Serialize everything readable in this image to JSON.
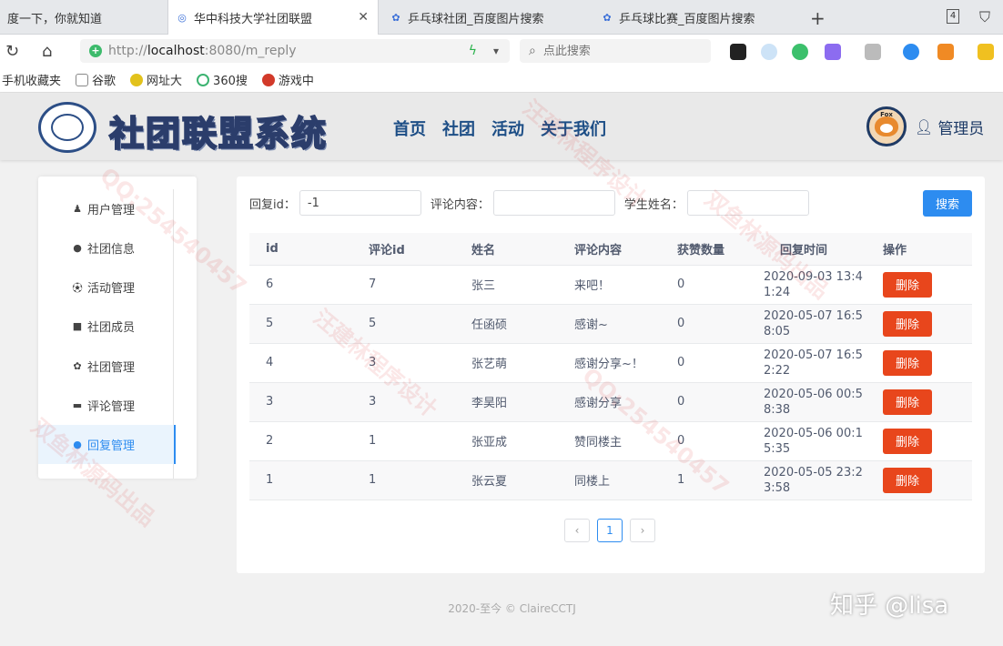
{
  "browser": {
    "tabs": [
      {
        "label": "度一下，你就知道",
        "active": false
      },
      {
        "label": "华中科技大学社团联盟",
        "active": true
      },
      {
        "label": "乒乓球社团_百度图片搜索",
        "active": false
      },
      {
        "label": "乒乓球比赛_百度图片搜索",
        "active": false
      }
    ],
    "tab_count": "4",
    "url_prefix": "http://",
    "url_host": "localhost",
    "url_rest": ":8080/m_reply",
    "search_placeholder": "点此搜索",
    "bookmarks": [
      "手机收藏夹",
      "谷歌",
      "网址大",
      "360搜",
      "游戏中"
    ]
  },
  "header": {
    "brand": "社团联盟系统",
    "nav": [
      "首页",
      "社团",
      "活动",
      "关于我们"
    ],
    "avatar_text": "Fox",
    "user": "管理员"
  },
  "sidebar": {
    "items": [
      {
        "label": "用户管理",
        "icon": "users-icon",
        "active": false
      },
      {
        "label": "社团信息",
        "icon": "chat-icon",
        "active": false
      },
      {
        "label": "活动管理",
        "icon": "ball-icon",
        "active": false
      },
      {
        "label": "社团成员",
        "icon": "folder-icon",
        "active": false
      },
      {
        "label": "社团管理",
        "icon": "gear-icon",
        "active": false
      },
      {
        "label": "评论管理",
        "icon": "comment-icon",
        "active": false
      },
      {
        "label": "回复管理",
        "icon": "reply-icon",
        "active": true
      }
    ]
  },
  "filters": {
    "reply_id_label": "回复id：",
    "reply_id_value": "-1",
    "comment_label": "评论内容：",
    "comment_value": "",
    "student_label": "学生姓名：",
    "student_value": "",
    "search_label": "搜索"
  },
  "table": {
    "columns": [
      "id",
      "评论id",
      "姓名",
      "评论内容",
      "获赞数量",
      "回复时间",
      "操作"
    ],
    "rows": [
      {
        "id": "6",
        "comment_id": "7",
        "name": "张三",
        "content": "来吧！",
        "likes": "0",
        "time": "2020-09-03 13:41:24"
      },
      {
        "id": "5",
        "comment_id": "5",
        "name": "任函硕",
        "content": "感谢~",
        "likes": "0",
        "time": "2020-05-07 16:58:05"
      },
      {
        "id": "4",
        "comment_id": "3",
        "name": "张艺萌",
        "content": "感谢分享~！",
        "likes": "0",
        "time": "2020-05-07 16:52:22"
      },
      {
        "id": "3",
        "comment_id": "3",
        "name": "李昊阳",
        "content": "感谢分享",
        "likes": "0",
        "time": "2020-05-06 00:58:38"
      },
      {
        "id": "2",
        "comment_id": "1",
        "name": "张亚成",
        "content": "赞同楼主",
        "likes": "0",
        "time": "2020-05-06 00:15:35"
      },
      {
        "id": "1",
        "comment_id": "1",
        "name": "张云夏",
        "content": "同楼上",
        "likes": "1",
        "time": "2020-05-05 23:23:58"
      }
    ],
    "delete_label": "删除"
  },
  "pagination": {
    "prev": "‹",
    "current": "1",
    "next": "›"
  },
  "footer": "2020-至今 © ClaireCCTJ",
  "watermark_credit": "知乎 @lisa",
  "watermarks": [
    "汪建林程序设计",
    "QQ:254540457",
    "双鱼林源码出品"
  ],
  "colors": {
    "primary": "#2d8cf0",
    "danger": "#e8461c",
    "brand_nav": "#1d4e86"
  }
}
